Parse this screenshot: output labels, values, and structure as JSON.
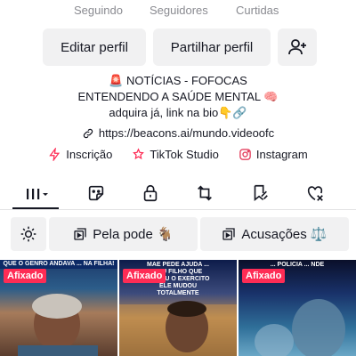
{
  "stats": {
    "following_label": "Seguindo",
    "followers_label": "Seguidores",
    "likes_label": "Curtidas"
  },
  "actions": {
    "edit_label": "Editar perfil",
    "share_label": "Partilhar perfil",
    "add_friend_icon": "add-friend-icon"
  },
  "bio": {
    "line1": "🚨 NOTÍCIAS - FOFOCAS",
    "line2": "ENTENDENDO A SAÚDE MENTAL 🧠",
    "line3": "adquira já, link na bio👇🔗",
    "link": "https://beacons.ai/mundo.videoofc"
  },
  "apps": [
    {
      "label": "Inscrição",
      "icon": "subscription-icon"
    },
    {
      "label": "TikTok Studio",
      "icon": "studio-icon"
    },
    {
      "label": "Instagram",
      "icon": "instagram-icon"
    }
  ],
  "tabs": [
    {
      "icon": "videos-grid-icon",
      "selected": true
    },
    {
      "icon": "sticker-icon"
    },
    {
      "icon": "lock-icon"
    },
    {
      "icon": "repost-icon"
    },
    {
      "icon": "favorites-icon"
    },
    {
      "icon": "liked-icon"
    }
  ],
  "filters": {
    "settings_icon": "gear-icon",
    "pela_pode": "Pela pode 🐐",
    "acusacoes": "Acusações ⚖️"
  },
  "videos": [
    {
      "pinned_label": "Afixado",
      "caption": "QUE O GENRO ANDAVA ... NA FILHA!"
    },
    {
      "pinned_label": "Afixado",
      "caption": "MAE PEDE AJUDA ... SEU FILHO QUE SERVIU O EXERCITO ELE MUDOU TOTALMENTE"
    },
    {
      "pinned_label": "Afixado",
      "caption": "... POLICIA ... NDE"
    }
  ],
  "colors": {
    "accent": "#fe2c55",
    "button_bg": "#f1f1f2",
    "text": "#161823",
    "muted": "#8a8b91"
  }
}
